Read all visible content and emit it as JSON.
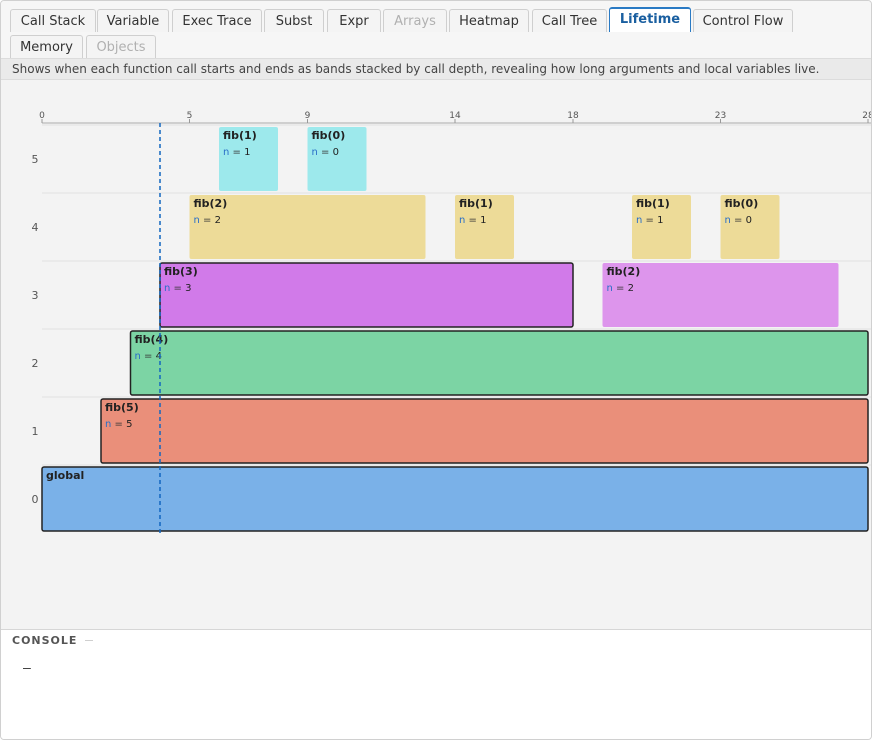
{
  "tabs": [
    {
      "label": "Call Stack",
      "state": "normal"
    },
    {
      "label": "Variable",
      "state": "normal"
    },
    {
      "label": "Exec Trace",
      "state": "normal"
    },
    {
      "label": "Subst",
      "state": "normal"
    },
    {
      "label": "Expr",
      "state": "normal"
    },
    {
      "label": "Arrays",
      "state": "disabled"
    },
    {
      "label": "Heatmap",
      "state": "normal"
    },
    {
      "label": "Call Tree",
      "state": "normal"
    },
    {
      "label": "Lifetime",
      "state": "active"
    },
    {
      "label": "Control Flow",
      "state": "normal"
    },
    {
      "label": "Memory",
      "state": "normal"
    },
    {
      "label": "Objects",
      "state": "disabled"
    }
  ],
  "description": "Shows when each function call starts and ends as bands stacked by call depth, revealing how long arguments and local variables live.",
  "lifetime": {
    "x_ticks": [
      "0",
      "5",
      "9",
      "14",
      "18",
      "23",
      "28"
    ],
    "x_range": [
      0,
      28
    ],
    "depths": [
      "0",
      "1",
      "2",
      "3",
      "4",
      "5"
    ],
    "current_step": 4,
    "calls": [
      {
        "name": "global",
        "depth": 0,
        "start": 0,
        "end": 28,
        "color": "#7ab1e8",
        "arg": "",
        "val": "",
        "active": true
      },
      {
        "name": "fib(5)",
        "depth": 1,
        "start": 2,
        "end": 28,
        "color": "#ea8f7a",
        "arg": "n",
        "val": "5",
        "active": true
      },
      {
        "name": "fib(4)",
        "depth": 2,
        "start": 3,
        "end": 28,
        "color": "#7cd4a4",
        "arg": "n",
        "val": "4",
        "active": true
      },
      {
        "name": "fib(3)",
        "depth": 3,
        "start": 4,
        "end": 18,
        "color": "#d17ae9",
        "arg": "n",
        "val": "3",
        "active": true
      },
      {
        "name": "fib(2)",
        "depth": 4,
        "start": 5,
        "end": 13,
        "color": "#eddb98",
        "arg": "n",
        "val": "2",
        "active": false
      },
      {
        "name": "fib(1)",
        "depth": 5,
        "start": 6,
        "end": 8,
        "color": "#9de9ec",
        "arg": "n",
        "val": "1",
        "active": false
      },
      {
        "name": "fib(0)",
        "depth": 5,
        "start": 9,
        "end": 11,
        "color": "#9de9ec",
        "arg": "n",
        "val": "0",
        "active": false
      },
      {
        "name": "fib(1)",
        "depth": 4,
        "start": 14,
        "end": 16,
        "color": "#eddb98",
        "arg": "n",
        "val": "1",
        "active": false
      },
      {
        "name": "fib(2)",
        "depth": 3,
        "start": 19,
        "end": 27,
        "color": "#dd95ec",
        "arg": "n",
        "val": "2",
        "active": false
      },
      {
        "name": "fib(1)",
        "depth": 4,
        "start": 20,
        "end": 22,
        "color": "#eddb98",
        "arg": "n",
        "val": "1",
        "active": false
      },
      {
        "name": "fib(0)",
        "depth": 4,
        "start": 23,
        "end": 25,
        "color": "#eddb98",
        "arg": "n",
        "val": "0",
        "active": false
      }
    ],
    "colors": {
      "grid": "#e2e2e2",
      "axis": "#cfcfcf",
      "marker": "#1166c0",
      "arg": "#2a6fc8",
      "text": "#222222"
    }
  },
  "console": {
    "title": "CONSOLE",
    "prompt": "—"
  }
}
